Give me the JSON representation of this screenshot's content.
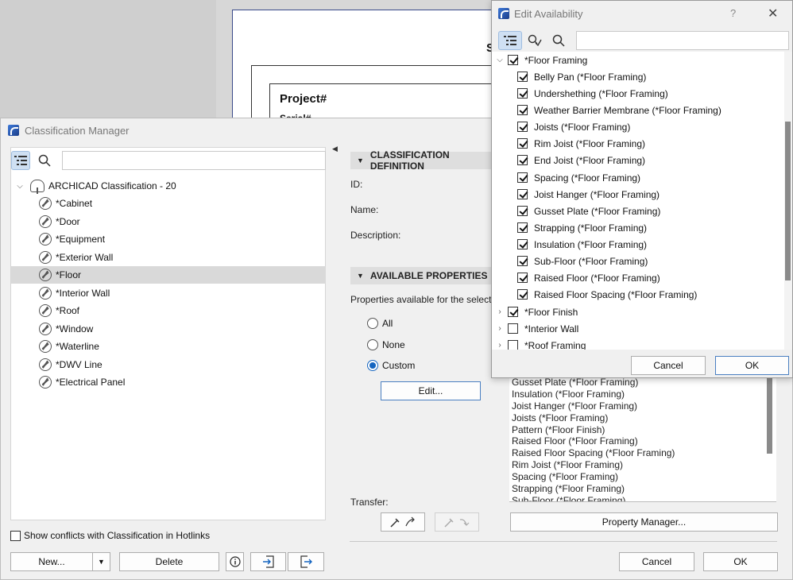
{
  "background": {
    "sheet_big_letter": "S",
    "title": "Project#",
    "subtitle": "Serial#"
  },
  "classification_manager": {
    "title": "Classification Manager",
    "tree": {
      "root": "ARCHICAD Classification - 20",
      "items": [
        "*Cabinet",
        "*Door",
        "*Equipment",
        "*Exterior Wall",
        "*Floor",
        "*Interior Wall",
        "*Roof",
        "*Window",
        "*Waterline",
        "*DWV Line",
        "*Electrical Panel"
      ],
      "selected": "*Floor"
    },
    "conflicts_label": "Show conflicts with Classification in Hotlinks",
    "buttons": {
      "new": "New...",
      "delete": "Delete",
      "edit": "Edit...",
      "property_manager": "Property Manager...",
      "cancel": "Cancel",
      "ok": "OK"
    },
    "definition": {
      "header": "CLASSIFICATION DEFINITION",
      "id_label": "ID:",
      "name_label": "Name:",
      "description_label": "Description:"
    },
    "available": {
      "header": "AVAILABLE PROPERTIES",
      "intro": "Properties available for the selected C",
      "options": [
        "All",
        "None",
        "Custom"
      ],
      "selected": "Custom"
    },
    "transfer_label": "Transfer:",
    "property_list": [
      "Gusset Plate (*Floor Framing)",
      "Insulation (*Floor Framing)",
      "Joist Hanger (*Floor Framing)",
      "Joists (*Floor Framing)",
      "Pattern (*Floor Finish)",
      "Raised Floor (*Floor Framing)",
      "Raised Floor Spacing (*Floor Framing)",
      "Rim Joist (*Floor Framing)",
      "Spacing (*Floor Framing)",
      "Strapping (*Floor Framing)",
      "Sub-Floor (*Floor Framing)"
    ]
  },
  "edit_availability": {
    "title": "Edit Availability",
    "help": "?",
    "group_open": {
      "label": "*Floor Framing",
      "checked": true
    },
    "children": [
      "Belly Pan (*Floor Framing)",
      "Undershething (*Floor Framing)",
      "Weather Barrier Membrane (*Floor Framing)",
      "Joists (*Floor Framing)",
      "Rim Joist (*Floor Framing)",
      "End Joist (*Floor Framing)",
      "Spacing (*Floor Framing)",
      "Joist Hanger (*Floor Framing)",
      "Gusset Plate (*Floor Framing)",
      "Strapping (*Floor Framing)",
      "Insulation (*Floor Framing)",
      "Sub-Floor (*Floor Framing)",
      "Raised Floor (*Floor Framing)",
      "Raised Floor Spacing (*Floor Framing)"
    ],
    "groups_closed": [
      {
        "label": "*Floor Finish",
        "checked": true
      },
      {
        "label": "*Interior Wall",
        "checked": false
      },
      {
        "label": "*Roof Framing",
        "checked": false
      }
    ],
    "buttons": {
      "cancel": "Cancel",
      "ok": "OK"
    }
  }
}
